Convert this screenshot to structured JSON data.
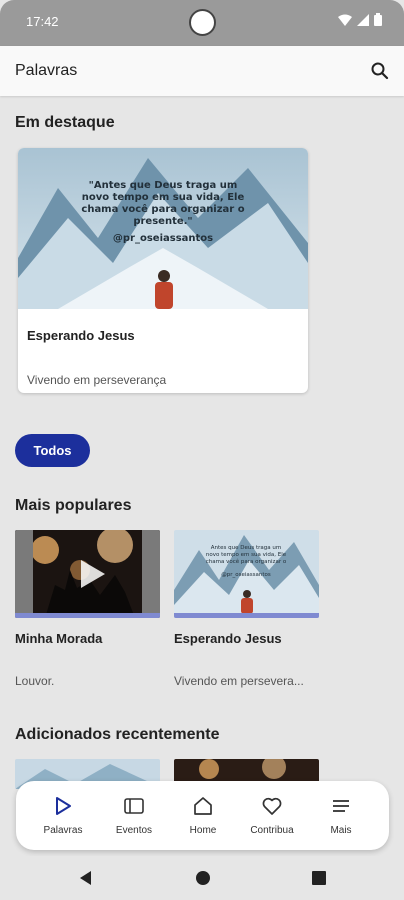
{
  "status_bar": {
    "time": "17:42"
  },
  "app_bar": {
    "title": "Palavras"
  },
  "featured": {
    "section_title": "Em destaque",
    "card": {
      "quote": "\"Antes que Deus traga um novo tempo em sua vida, Ele chama você para organizar o presente.\"",
      "handle": "@pr_oseiassantos",
      "title": "Esperando Jesus",
      "subtitle": "Vivendo em perseverança"
    }
  },
  "filter_chip": "Todos",
  "popular": {
    "section_title": "Mais populares",
    "items": [
      {
        "title": "Minha Morada",
        "subtitle": "Louvor."
      },
      {
        "title": "Esperando Jesus",
        "subtitle": "Vivendo em persevera..."
      }
    ]
  },
  "recent": {
    "section_title": "Adicionados recentemente"
  },
  "bottom_nav": {
    "items": [
      {
        "label": "Palavras",
        "icon": "play-icon",
        "active": true
      },
      {
        "label": "Eventos",
        "icon": "events-icon"
      },
      {
        "label": "Home",
        "icon": "home-icon"
      },
      {
        "label": "Contribua",
        "icon": "heart-icon"
      },
      {
        "label": "Mais",
        "icon": "menu-icon"
      }
    ]
  },
  "colors": {
    "accent": "#1c2f9c",
    "nav_active": "#1c2f9c",
    "background": "#e6e6e6"
  }
}
